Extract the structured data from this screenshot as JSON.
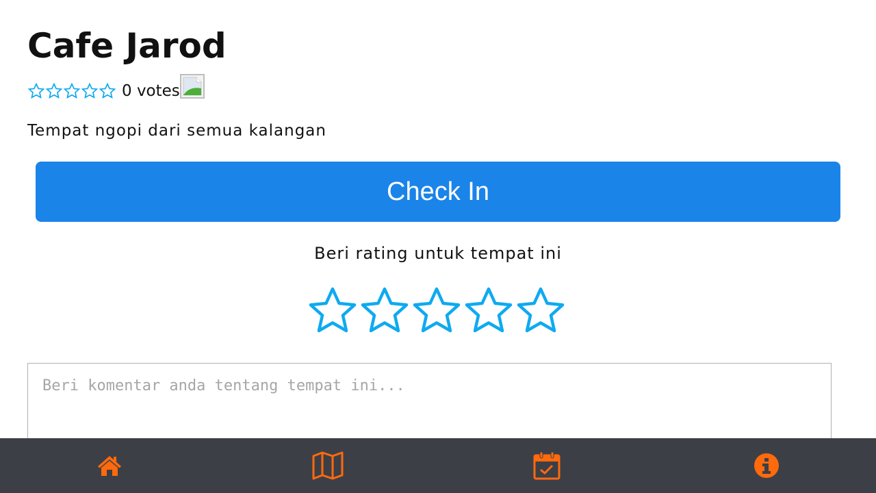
{
  "place": {
    "name": "Cafe Jarod",
    "rating_stars_filled": 0,
    "rating_stars_total": 5,
    "votes_label": "0 votes",
    "description": "Tempat ngopi dari semua kalangan"
  },
  "actions": {
    "check_in_label": "Check In"
  },
  "rate": {
    "label": "Beri rating untuk tempat ini",
    "selected": 0,
    "total": 5
  },
  "comment": {
    "value": "",
    "placeholder": "Beri komentar anda tentang tempat ini..."
  },
  "bottom_nav": {
    "items": [
      {
        "name": "home",
        "icon": "home-icon"
      },
      {
        "name": "map",
        "icon": "map-icon"
      },
      {
        "name": "calendar",
        "icon": "calendar-check-icon"
      },
      {
        "name": "info",
        "icon": "info-icon"
      }
    ]
  },
  "colors": {
    "accent_blue": "#1b84e8",
    "star_blue": "#0eaaf0",
    "nav_bg": "#3d3f47",
    "nav_icon": "#ff6a0d"
  }
}
